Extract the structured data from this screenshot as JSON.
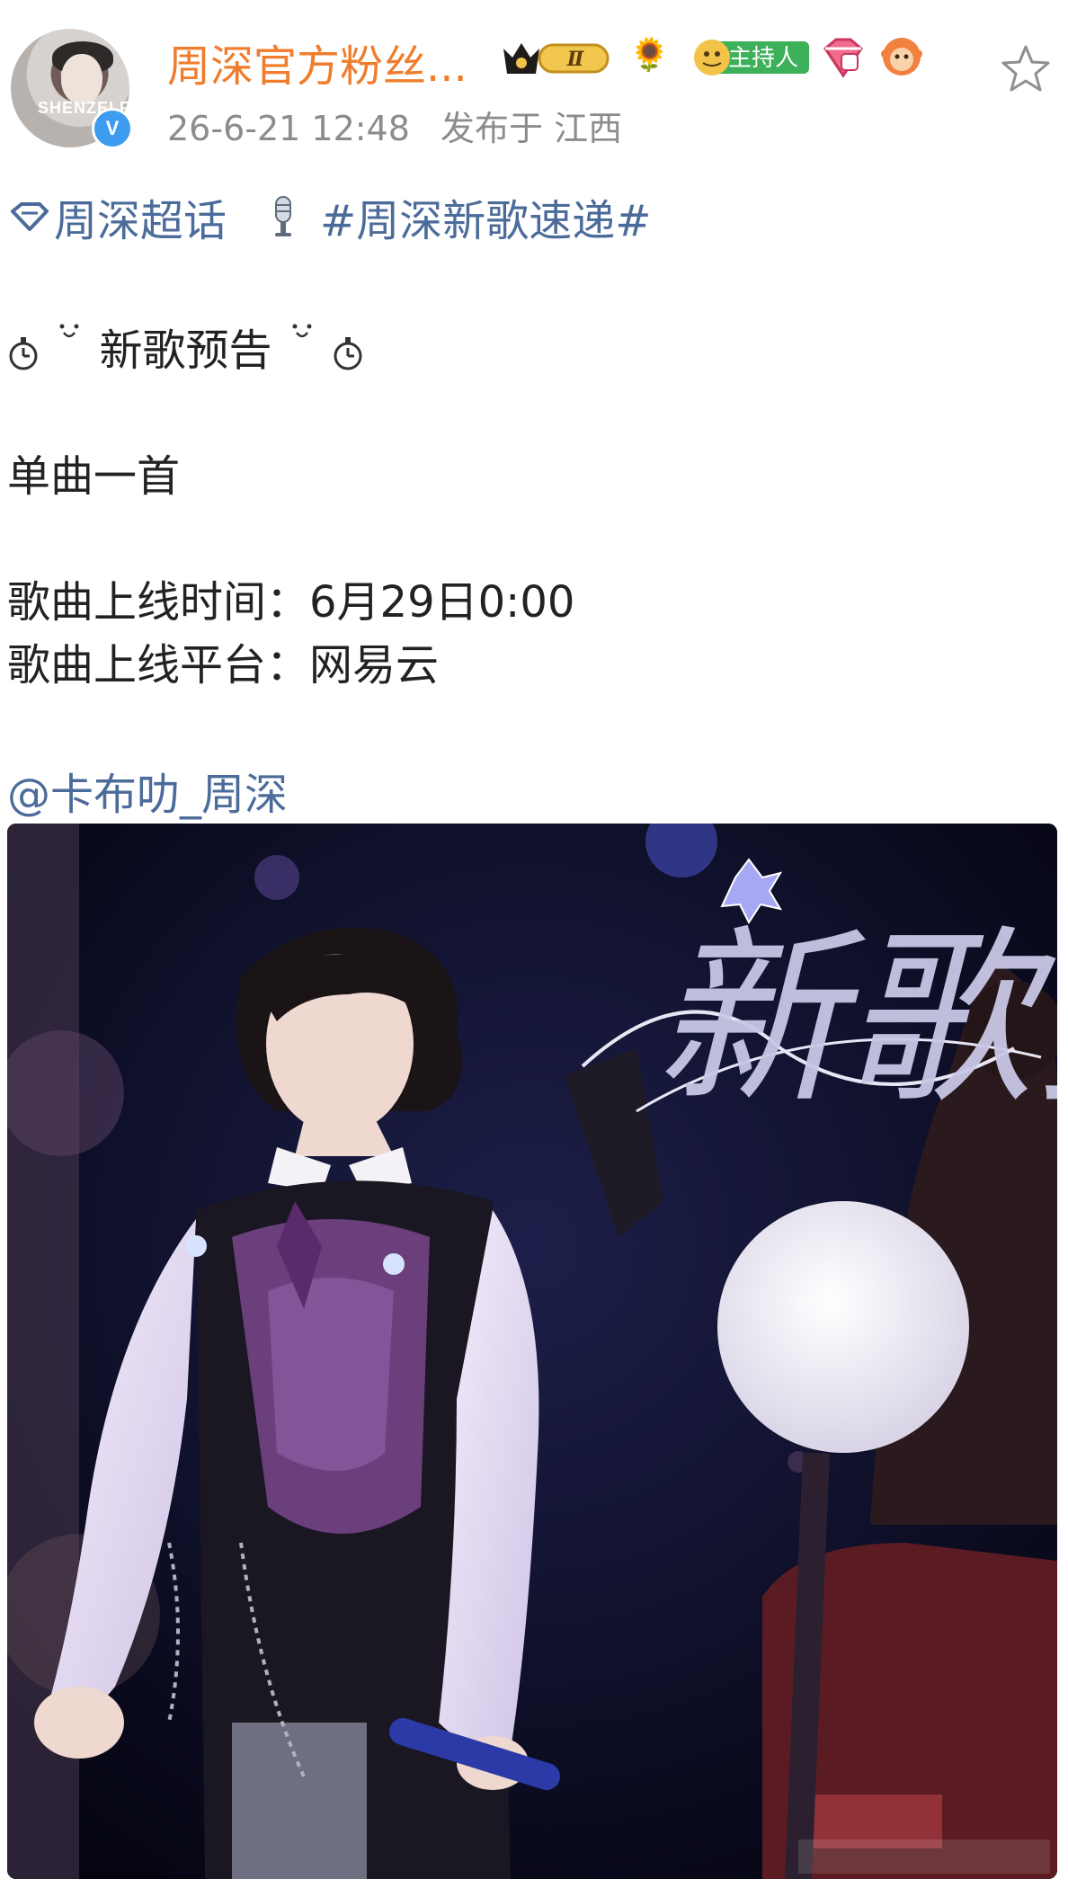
{
  "post": {
    "author": {
      "name": "周深官方粉丝...",
      "avatar_text": "SHENZELF",
      "verified": "V",
      "level": "Ⅱ",
      "host_badge": "主持人"
    },
    "meta": {
      "timestamp": "26-6-21 12:48",
      "location": "发布于 江西"
    },
    "topics": {
      "supertopic": "周深超话",
      "hashtag": "#周深新歌速递#"
    },
    "lines": {
      "announcement": "新歌预告",
      "single": "单曲一首",
      "release_time": "歌曲上线时间：6月29日0:00",
      "release_platform": "歌曲上线平台：网易云"
    },
    "mention": "@卡布叻_周深",
    "image": {
      "overlay_text": "新歌预告"
    }
  },
  "colors": {
    "username": "#f07c2c",
    "link": "#4b6c9a",
    "meta": "#8c8c8c",
    "text": "#222222",
    "verified": "#3d9cf0"
  },
  "icons": [
    "supertopic-icon",
    "microphone-icon",
    "stopwatch-icon",
    "star-outline-icon",
    "gem-badge-icon",
    "monkey-badge-icon",
    "sunflower-icon",
    "crown-icon"
  ]
}
